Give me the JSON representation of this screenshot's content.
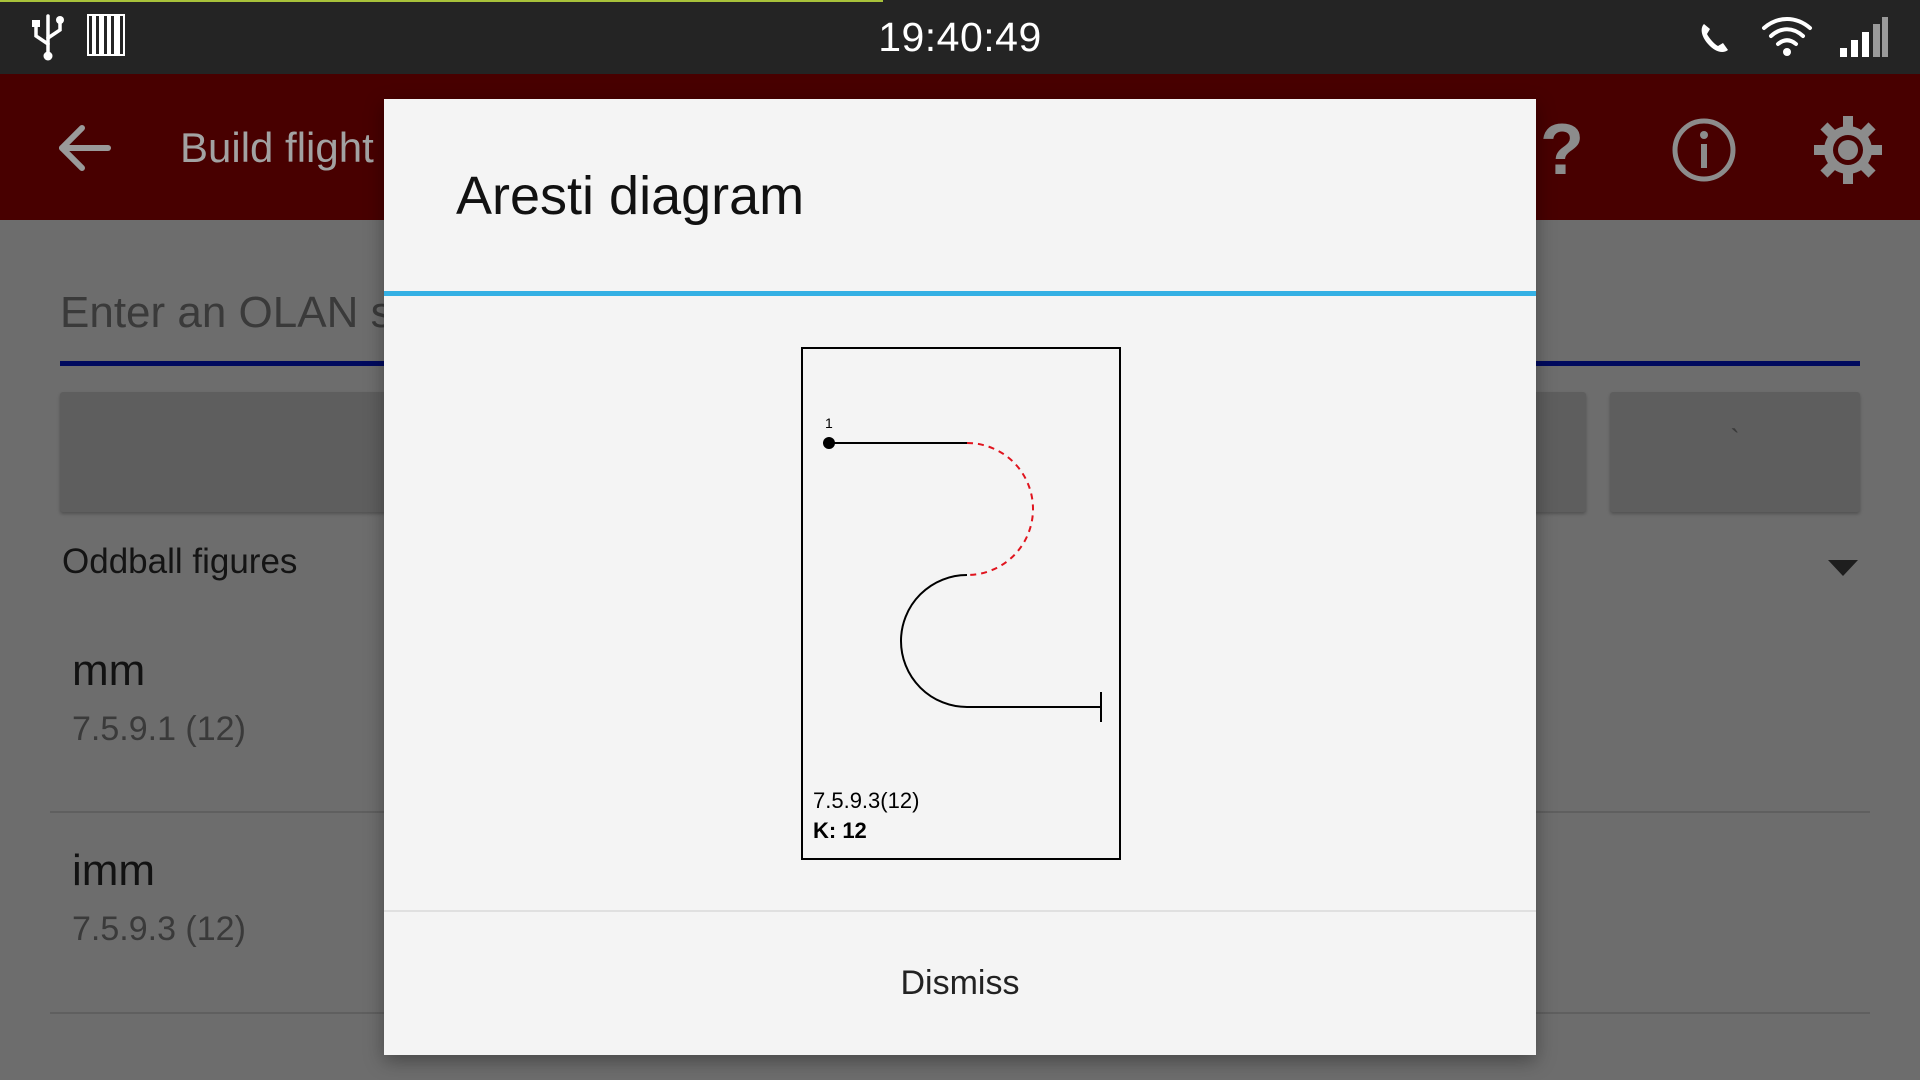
{
  "status_bar": {
    "time": "19:40:49",
    "icons": [
      "usb-icon",
      "barcode-icon",
      "phone-call-icon",
      "wifi-icon",
      "cell-signal-icon"
    ]
  },
  "app_bar": {
    "title": "Build flight",
    "background": "#8b0000",
    "actions": [
      "help-icon",
      "info-icon",
      "settings-icon"
    ]
  },
  "olan_input": {
    "placeholder": "Enter an OLAN sequence"
  },
  "buttons": {
    "right_label": "`"
  },
  "category": {
    "selected": "Oddball figures"
  },
  "figures": [
    {
      "name": "mm",
      "code": "7.5.9.1 (12)"
    },
    {
      "name": "imm",
      "code": "7.5.9.3 (12)"
    }
  ],
  "dialog": {
    "title": "Aresti diagram",
    "accent": "#34b0e4",
    "diagram": {
      "start_number": "1",
      "figure_code": "7.5.9.3(12)",
      "k_label": "K: 12"
    },
    "dismiss_label": "Dismiss"
  }
}
